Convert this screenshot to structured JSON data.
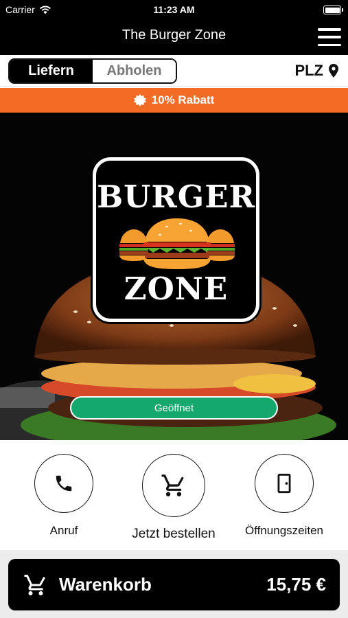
{
  "status_bar": {
    "carrier": "Carrier",
    "time": "11:23 AM"
  },
  "nav": {
    "title": "The Burger Zone",
    "menu_icon": "hamburger-menu-icon"
  },
  "mode": {
    "delivery": "Liefern",
    "pickup": "Abholen",
    "selected": "Liefern",
    "plz": "PLZ"
  },
  "discount": {
    "text": "10% Rabatt"
  },
  "hero": {
    "logo_top": "BURGER",
    "logo_bottom": "ZONE",
    "status": "Geöffnet"
  },
  "actions": {
    "call": "Anruf",
    "order": "Jetzt bestellen",
    "hours": "Öffnungszeiten"
  },
  "cart": {
    "label": "Warenkorb",
    "total": "15,75 €"
  },
  "colors": {
    "accent": "#f36b24",
    "open_green": "#14a86c",
    "dark": "#000000"
  }
}
